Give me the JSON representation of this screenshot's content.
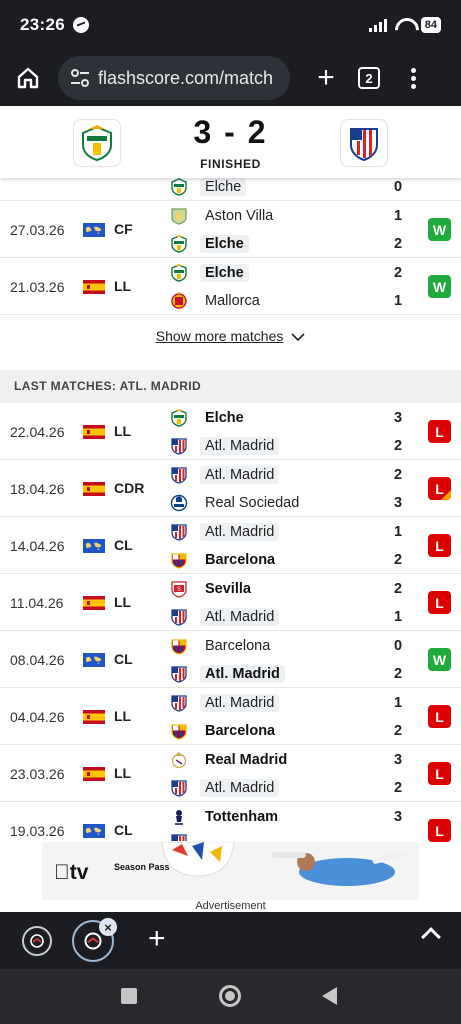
{
  "status_bar": {
    "time": "23:26",
    "battery": "84"
  },
  "browser": {
    "url": "flashscore.com/match",
    "tab_count": "2"
  },
  "match_header": {
    "score": "3 - 2",
    "status": "FINISHED",
    "home_logo": "elche-crest",
    "away_logo": "atletico-madrid-crest"
  },
  "elche_matches": {
    "partial_row": {
      "team": "Elche",
      "score": "0"
    },
    "rows": [
      {
        "date": "27.03.26",
        "flag": "world",
        "competition": "CF",
        "team1": {
          "name": "Aston Villa",
          "crest": "aston-villa",
          "bold": false,
          "highlight": false,
          "score": "1"
        },
        "team2": {
          "name": "Elche",
          "crest": "elche",
          "bold": true,
          "highlight": true,
          "score": "2"
        },
        "result": "W",
        "mixed": false
      },
      {
        "date": "21.03.26",
        "flag": "spain",
        "competition": "LL",
        "team1": {
          "name": "Elche",
          "crest": "elche",
          "bold": true,
          "highlight": true,
          "score": "2"
        },
        "team2": {
          "name": "Mallorca",
          "crest": "mallorca",
          "bold": false,
          "highlight": false,
          "score": "1"
        },
        "result": "W",
        "mixed": false
      }
    ],
    "show_more_label": "Show more matches"
  },
  "atl_section": {
    "title": "LAST MATCHES: ATL. MADRID",
    "rows": [
      {
        "date": "22.04.26",
        "flag": "spain",
        "competition": "LL",
        "team1": {
          "name": "Elche",
          "crest": "elche",
          "bold": true,
          "highlight": false,
          "score": "3"
        },
        "team2": {
          "name": "Atl. Madrid",
          "crest": "atletico",
          "bold": false,
          "highlight": true,
          "score": "2"
        },
        "result": "L",
        "mixed": false
      },
      {
        "date": "18.04.26",
        "flag": "spain",
        "competition": "CDR",
        "team1": {
          "name": "Atl. Madrid",
          "crest": "atletico",
          "bold": false,
          "highlight": true,
          "score": "2"
        },
        "team2": {
          "name": "Real Sociedad",
          "crest": "real-sociedad",
          "bold": false,
          "highlight": false,
          "score": "3"
        },
        "result": "L",
        "mixed": true
      },
      {
        "date": "14.04.26",
        "flag": "world",
        "competition": "CL",
        "team1": {
          "name": "Atl. Madrid",
          "crest": "atletico",
          "bold": false,
          "highlight": true,
          "score": "1"
        },
        "team2": {
          "name": "Barcelona",
          "crest": "barcelona",
          "bold": true,
          "highlight": false,
          "score": "2"
        },
        "result": "L",
        "mixed": false
      },
      {
        "date": "11.04.26",
        "flag": "spain",
        "competition": "LL",
        "team1": {
          "name": "Sevilla",
          "crest": "sevilla",
          "bold": true,
          "highlight": false,
          "score": "2"
        },
        "team2": {
          "name": "Atl. Madrid",
          "crest": "atletico",
          "bold": false,
          "highlight": true,
          "score": "1"
        },
        "result": "L",
        "mixed": false
      },
      {
        "date": "08.04.26",
        "flag": "world",
        "competition": "CL",
        "team1": {
          "name": "Barcelona",
          "crest": "barcelona",
          "bold": false,
          "highlight": false,
          "score": "0"
        },
        "team2": {
          "name": "Atl. Madrid",
          "crest": "atletico",
          "bold": true,
          "highlight": true,
          "score": "2"
        },
        "result": "W",
        "mixed": false
      },
      {
        "date": "04.04.26",
        "flag": "spain",
        "competition": "LL",
        "team1": {
          "name": "Atl. Madrid",
          "crest": "atletico",
          "bold": false,
          "highlight": true,
          "score": "1"
        },
        "team2": {
          "name": "Barcelona",
          "crest": "barcelona",
          "bold": true,
          "highlight": false,
          "score": "2"
        },
        "result": "L",
        "mixed": false
      },
      {
        "date": "23.03.26",
        "flag": "spain",
        "competition": "LL",
        "team1": {
          "name": "Real Madrid",
          "crest": "real-madrid",
          "bold": true,
          "highlight": false,
          "score": "3"
        },
        "team2": {
          "name": "Atl. Madrid",
          "crest": "atletico",
          "bold": false,
          "highlight": true,
          "score": "2"
        },
        "result": "L",
        "mixed": false
      },
      {
        "date": "19.03.26",
        "flag": "world",
        "competition": "CL",
        "team1": {
          "name": "Tottenham",
          "crest": "tottenham",
          "bold": true,
          "highlight": false,
          "score": "3"
        },
        "team2": {
          "name": "",
          "crest": "atletico",
          "bold": false,
          "highlight": false,
          "score": ""
        },
        "result": "L",
        "mixed": false
      }
    ]
  },
  "ad": {
    "brand": "tv",
    "text": "Season Pass",
    "label": "Advertisement"
  },
  "colors": {
    "win": "#1fab3b",
    "loss": "#dc0000",
    "draw_accent": "#f3a000",
    "chrome": "#1b1d22"
  }
}
